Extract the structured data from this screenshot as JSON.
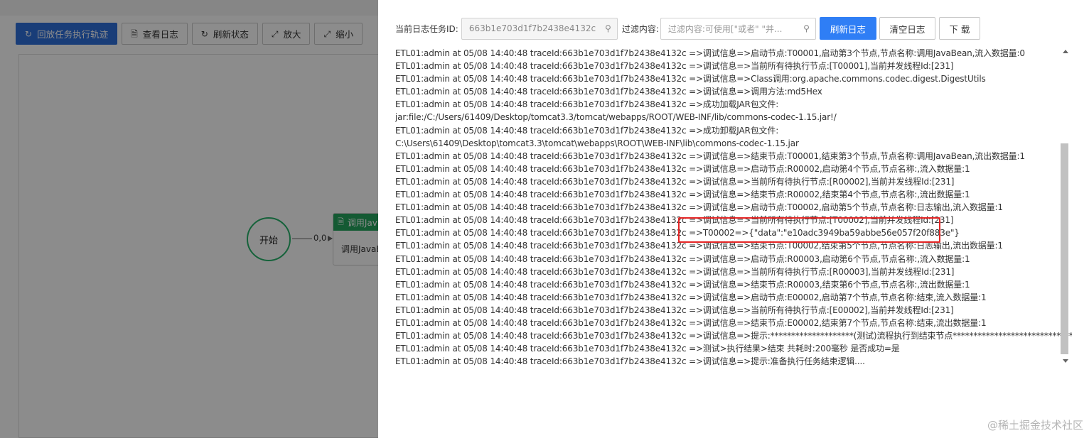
{
  "background_app": {
    "toolbar": [
      {
        "label": "回放任务执行轨迹",
        "icon": "replay-icon"
      },
      {
        "label": "查看日志",
        "icon": "document-icon"
      },
      {
        "label": "刷新状态",
        "icon": "refresh-icon"
      },
      {
        "label": "放大",
        "icon": "zoom-in-icon"
      },
      {
        "label": "缩小",
        "icon": "zoom-out-icon"
      }
    ],
    "start_node_label": "开始",
    "edge_label": "0,0",
    "java_node_title": "调用Jav",
    "java_node_body": "调用JavaB"
  },
  "log_panel": {
    "task_id_label": "当前日志任务ID:",
    "task_id_value": "663b1e703d1f7b2438e4132c",
    "filter_label": "过滤内容:",
    "filter_placeholder": "过滤内容:可使用[\"或者\" \"并...",
    "refresh_button": "刷新日志",
    "clear_button": "清空日志",
    "download_button": "下 载",
    "lines": [
      "ETL01:admin at 05/08 14:40:48 traceId:663b1e703d1f7b2438e4132c =>调试信息=>启动节点:T00001,启动第3个节点,节点名称:调用JavaBean,流入数据量:0",
      "ETL01:admin at 05/08 14:40:48 traceId:663b1e703d1f7b2438e4132c =>调试信息=>当前所有待执行节点:[T00001],当前并发线程Id:[231]",
      "ETL01:admin at 05/08 14:40:48 traceId:663b1e703d1f7b2438e4132c =>调试信息=>Class调用:org.apache.commons.codec.digest.DigestUtils",
      "ETL01:admin at 05/08 14:40:48 traceId:663b1e703d1f7b2438e4132c =>调试信息=>调用方法:md5Hex",
      "ETL01:admin at 05/08 14:40:48 traceId:663b1e703d1f7b2438e4132c =>成功加载JAR包文件: jar:file:/C:/Users/61409/Desktop/tomcat3.3/tomcat/webapps/ROOT/WEB-INF/lib/commons-codec-1.15.jar!/",
      "ETL01:admin at 05/08 14:40:48 traceId:663b1e703d1f7b2438e4132c =>成功卸载JAR包文件: C:\\Users\\61409\\Desktop\\tomcat3.3\\tomcat\\webapps\\ROOT\\WEB-INF\\lib\\commons-codec-1.15.jar",
      "ETL01:admin at 05/08 14:40:48 traceId:663b1e703d1f7b2438e4132c =>调试信息=>结束节点:T00001,结束第3个节点,节点名称:调用JavaBean,流出数据量:1",
      "ETL01:admin at 05/08 14:40:48 traceId:663b1e703d1f7b2438e4132c =>调试信息=>启动节点:R00002,启动第4个节点,节点名称:,流入数据量:1",
      "ETL01:admin at 05/08 14:40:48 traceId:663b1e703d1f7b2438e4132c =>调试信息=>当前所有待执行节点:[R00002],当前并发线程Id:[231]",
      "ETL01:admin at 05/08 14:40:48 traceId:663b1e703d1f7b2438e4132c =>调试信息=>结束节点:R00002,结束第4个节点,节点名称:,流出数据量:1",
      "ETL01:admin at 05/08 14:40:48 traceId:663b1e703d1f7b2438e4132c =>调试信息=>启动节点:T00002,启动第5个节点,节点名称:日志输出,流入数据量:1",
      "ETL01:admin at 05/08 14:40:48 traceId:663b1e703d1f7b2438e4132c =>调试信息=>当前所有待执行节点:[T00002],当前并发线程Id:[231]",
      "ETL01:admin at 05/08 14:40:48 traceId:663b1e703d1f7b2438e4132c =>T00002=>{\"data\":\"e10adc3949ba59abbe56e057f20f883e\"}",
      "ETL01:admin at 05/08 14:40:48 traceId:663b1e703d1f7b2438e4132c =>调试信息=>结束节点:T00002,结束第5个节点,节点名称:日志输出,流出数据量:1",
      "ETL01:admin at 05/08 14:40:48 traceId:663b1e703d1f7b2438e4132c =>调试信息=>启动节点:R00003,启动第6个节点,节点名称:,流入数据量:1",
      "ETL01:admin at 05/08 14:40:48 traceId:663b1e703d1f7b2438e4132c =>调试信息=>当前所有待执行节点:[R00003],当前并发线程Id:[231]",
      "ETL01:admin at 05/08 14:40:48 traceId:663b1e703d1f7b2438e4132c =>调试信息=>结束节点:R00003,结束第6个节点,节点名称:,流出数据量:1",
      "ETL01:admin at 05/08 14:40:48 traceId:663b1e703d1f7b2438e4132c =>调试信息=>启动节点:E00002,启动第7个节点,节点名称:结束,流入数据量:1",
      "ETL01:admin at 05/08 14:40:48 traceId:663b1e703d1f7b2438e4132c =>调试信息=>当前所有待执行节点:[E00002],当前并发线程Id:[231]",
      "ETL01:admin at 05/08 14:40:48 traceId:663b1e703d1f7b2438e4132c =>调试信息=>结束节点:E00002,结束第7个节点,节点名称:结束,流出数据量:1",
      "ETL01:admin at 05/08 14:40:48 traceId:663b1e703d1f7b2438e4132c =>调试信息=>提示:********************(测试)流程执行到结束节点******************************",
      "ETL01:admin at 05/08 14:40:48 traceId:663b1e703d1f7b2438e4132c =>测试>执行结果>结束 共耗时:200毫秒 是否成功=是",
      "ETL01:admin at 05/08 14:40:48 traceId:663b1e703d1f7b2438e4132c =>调试信息=>提示:准备执行任务结束逻辑...."
    ]
  },
  "watermark": "@稀土掘金技术社区",
  "colors": {
    "primary": "#2f6fdb",
    "refresh_button": "#2f7ef5",
    "node_green": "#25a55d",
    "highlight_red": "#e52525"
  }
}
